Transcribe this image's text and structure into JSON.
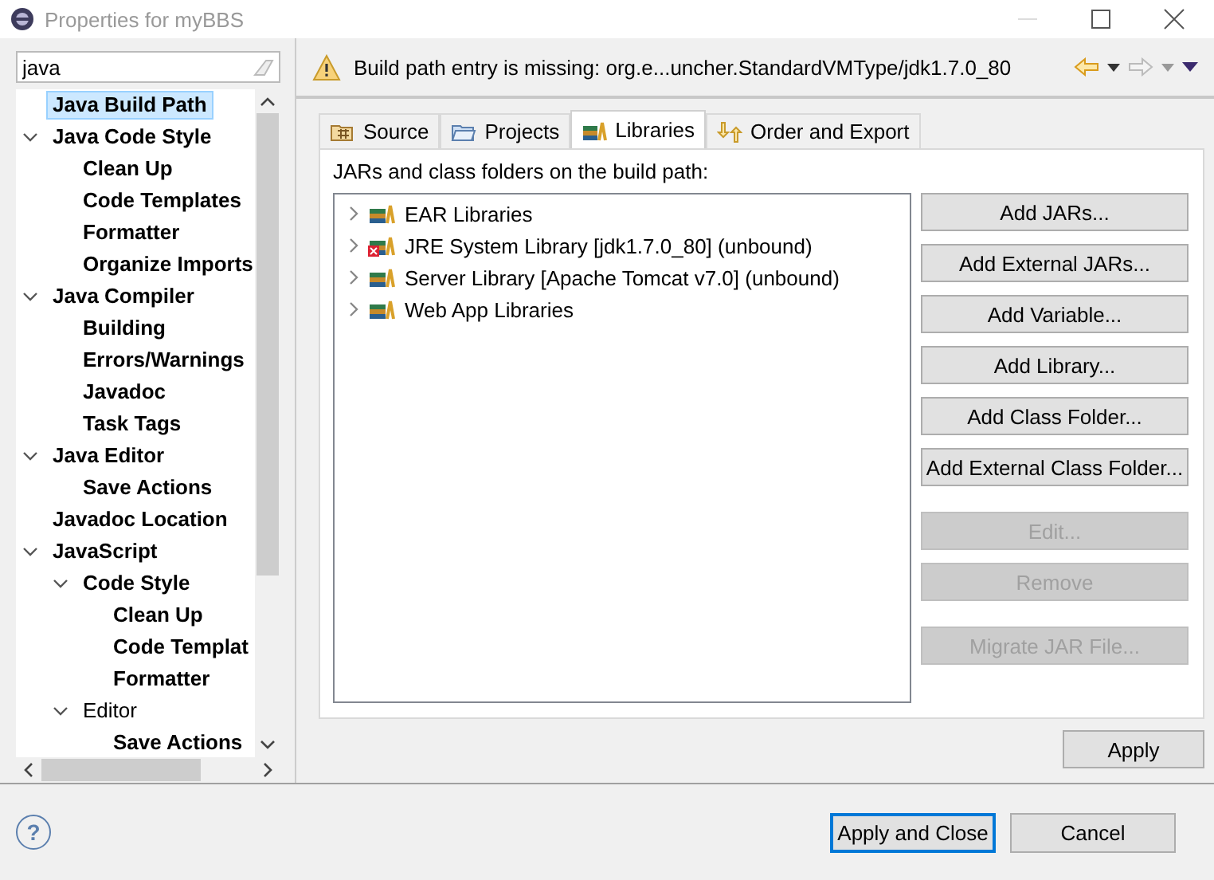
{
  "window": {
    "title": "Properties for myBBS"
  },
  "filter": {
    "value": "java"
  },
  "tree": [
    {
      "label": "Java Build Path",
      "selected": true,
      "matched": true
    },
    {
      "label": "Java Code Style",
      "selected": false,
      "matched": true,
      "expanded": true,
      "children": [
        {
          "label": "Clean Up",
          "selected": false,
          "matched": true
        },
        {
          "label": "Code Templates",
          "selected": false,
          "matched": true
        },
        {
          "label": "Formatter",
          "selected": false,
          "matched": true
        },
        {
          "label": "Organize Imports",
          "selected": false,
          "matched": true
        }
      ]
    },
    {
      "label": "Java Compiler",
      "selected": false,
      "matched": true,
      "expanded": true,
      "children": [
        {
          "label": "Building",
          "selected": false,
          "matched": true
        },
        {
          "label": "Errors/Warnings",
          "selected": false,
          "matched": true
        },
        {
          "label": "Javadoc",
          "selected": false,
          "matched": true
        },
        {
          "label": "Task Tags",
          "selected": false,
          "matched": true
        }
      ]
    },
    {
      "label": "Java Editor",
      "selected": false,
      "matched": true,
      "expanded": true,
      "children": [
        {
          "label": "Save Actions",
          "selected": false,
          "matched": true
        }
      ]
    },
    {
      "label": "Javadoc Location",
      "selected": false,
      "matched": true
    },
    {
      "label": "JavaScript",
      "selected": false,
      "matched": true,
      "expanded": true,
      "children": [
        {
          "label": "Code Style",
          "selected": false,
          "matched": true,
          "expanded": true,
          "children": [
            {
              "label": "Clean Up",
              "selected": false,
              "matched": true
            },
            {
              "label": "Code Templat",
              "selected": false,
              "matched": true
            },
            {
              "label": "Formatter",
              "selected": false,
              "matched": true
            }
          ]
        },
        {
          "label": "Editor",
          "selected": false,
          "matched": false,
          "expanded": true,
          "children": [
            {
              "label": "Save Actions",
              "selected": false,
              "matched": true
            }
          ]
        }
      ]
    }
  ],
  "message": {
    "kind": "warning",
    "text": "Build path entry is missing: org.e...uncher.StandardVMType/jdk1.7.0_80"
  },
  "tabs": [
    {
      "label": "Source",
      "kind": "source",
      "selected": false
    },
    {
      "label": "Projects",
      "kind": "projects",
      "selected": false
    },
    {
      "label": "Libraries",
      "kind": "libraries",
      "selected": true
    },
    {
      "label": "Order and Export",
      "kind": "order",
      "selected": false
    }
  ],
  "list_label": "JARs and class folders on the build path:",
  "libraries": [
    {
      "label": "EAR Libraries",
      "error": false
    },
    {
      "label": "JRE System Library [jdk1.7.0_80] (unbound)",
      "error": true
    },
    {
      "label": "Server Library [Apache Tomcat v7.0] (unbound)",
      "error": false
    },
    {
      "label": "Web App Libraries",
      "error": false
    }
  ],
  "button_groups": [
    [
      {
        "label": "Add JARs...",
        "disabled": false
      },
      {
        "label": "Add External JARs...",
        "disabled": false
      },
      {
        "label": "Add Variable...",
        "disabled": false
      },
      {
        "label": "Add Library...",
        "disabled": false
      },
      {
        "label": "Add Class Folder...",
        "disabled": false
      },
      {
        "label": "Add External Class Folder...",
        "disabled": false
      }
    ],
    [
      {
        "label": "Edit...",
        "disabled": true
      },
      {
        "label": "Remove",
        "disabled": true
      }
    ],
    [
      {
        "label": "Migrate JAR File...",
        "disabled": true
      }
    ]
  ],
  "apply_button": "Apply",
  "help_button": "?",
  "footer_buttons": [
    {
      "label": "Apply and Close",
      "default": true
    },
    {
      "label": "Cancel",
      "default": false
    }
  ]
}
